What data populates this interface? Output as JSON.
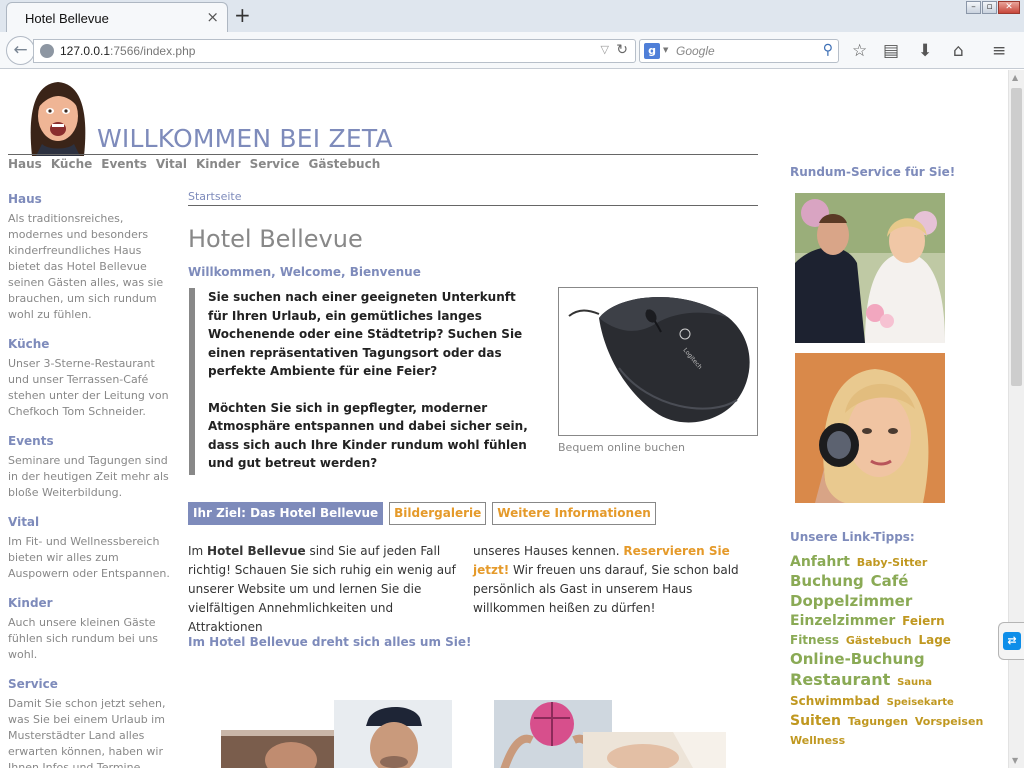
{
  "colors": {
    "accent_blue": "#7e8bbb",
    "accent_orange": "#e59a2a",
    "tag_green": "#8aaa55",
    "tag_gold": "#c09820",
    "text_gray": "#888888"
  },
  "browser": {
    "tab_title": "Hotel Bellevue",
    "tab_close": "×",
    "new_tab": "+",
    "url_host": "127.0.0.1",
    "url_rest": ":7566/index.php",
    "search_placeholder": "Google",
    "search_engine_letter": "g",
    "icons": [
      "back-arrow-icon",
      "globe-icon",
      "dropdown-icon",
      "reload-icon",
      "google-icon",
      "search-icon",
      "star-icon",
      "reading-list-icon",
      "download-icon",
      "home-icon",
      "menu-icon"
    ]
  },
  "header": {
    "title": "WILLKOMMEN BEI ZETA",
    "nav": [
      "Haus",
      "Küche",
      "Events",
      "Vital",
      "Kinder",
      "Service",
      "Gästebuch"
    ]
  },
  "sidebar": {
    "sections": [
      {
        "title": "Haus",
        "text": "Als traditionsreiches, modernes und besonders kinderfreundliches Haus bietet das Hotel Bellevue seinen Gästen alles, was sie brauchen, um sich rundum wohl zu fühlen."
      },
      {
        "title": "Küche",
        "text": "Unser 3-Sterne-Restaurant und unser Terrassen-Café stehen unter der Leitung von Chefkoch Tom Schneider."
      },
      {
        "title": "Events",
        "text": "Seminare und Tagungen sind in der heutigen Zeit mehr als bloße Weiterbildung."
      },
      {
        "title": "Vital",
        "text": "Im Fit- und Wellnessbereich bieten wir alles zum Auspowern oder Entspannen."
      },
      {
        "title": "Kinder",
        "text": "Auch unsere kleinen Gäste fühlen sich rundum bei uns wohl."
      },
      {
        "title": "Service",
        "text": "Damit Sie schon jetzt sehen, was Sie bei einem Urlaub im Musterstädter Land alles erwarten können, haben wir Ihnen Infos und Termine zusammengestellt."
      }
    ]
  },
  "main": {
    "breadcrumb": "Startseite",
    "heading": "Hotel Bellevue",
    "welcome": "Willkommen, Welcome, Bienvenue",
    "intro_p1": "Sie suchen nach einer geeigneten Unterkunft für Ihren Urlaub, ein gemütliches langes Wochenende oder eine Städtetrip? Suchen Sie einen repräsentativen Tagungsort oder das perfekte Ambiente für eine Feier?",
    "intro_p2": "Möchten Sie sich in gepflegter, moderner Atmosphäre entspannen und dabei sicher sein, dass sich auch Ihre Kinder rundum wohl fühlen und gut betreut werden?",
    "image_caption": "Bequem online buchen",
    "mouse_brand": "Logitech",
    "tabs": [
      "Ihr Ziel: Das Hotel Bellevue",
      "Bildergalerie",
      "Weitere Informationen"
    ],
    "col_a_pre": "Im ",
    "col_a_bold": "Hotel Bellevue",
    "col_a_post": " sind Sie auf jeden Fall richtig! Schauen Sie sich ruhig ein wenig auf unserer Website um und lernen Sie die vielfältigen Annehmlichkeiten und Attraktionen",
    "col_b_pre": "unseres Hauses kennen. ",
    "col_b_link": "Reservieren Sie jetzt!",
    "col_b_post": " Wir freuen uns darauf, Sie schon bald persönlich als Gast in unserem Haus willkommen heißen zu dürfen!",
    "tagline": "Im Hotel Bellevue dreht sich alles um Sie!"
  },
  "right": {
    "heading1": "Rundum-Service für Sie!",
    "heading2": "Unsere Link-Tipps:",
    "tags": [
      {
        "label": "Anfahrt",
        "size": "s4",
        "color": "green"
      },
      {
        "label": "Baby-Sitter",
        "size": "s2",
        "color": "gold"
      },
      {
        "label": "Buchung",
        "size": "s5",
        "color": "green"
      },
      {
        "label": "Café",
        "size": "s5",
        "color": "green"
      },
      {
        "label": "Doppelzimmer",
        "size": "s5",
        "color": "green"
      },
      {
        "label": "Einzelzimmer",
        "size": "s4",
        "color": "green"
      },
      {
        "label": "Feiern",
        "size": "s3",
        "color": "gold"
      },
      {
        "label": "Fitness",
        "size": "s3",
        "color": "green"
      },
      {
        "label": "Gästebuch",
        "size": "s2",
        "color": "gold"
      },
      {
        "label": "Lage",
        "size": "s3",
        "color": "gold"
      },
      {
        "label": "Online-Buchung",
        "size": "s5",
        "color": "green"
      },
      {
        "label": "Restaurant",
        "size": "s6",
        "color": "green"
      },
      {
        "label": "Sauna",
        "size": "s1",
        "color": "gold"
      },
      {
        "label": "Schwimmbad",
        "size": "s3",
        "color": "gold"
      },
      {
        "label": "Speisekarte",
        "size": "s1",
        "color": "gold"
      },
      {
        "label": "Suiten",
        "size": "s4",
        "color": "gold"
      },
      {
        "label": "Tagungen",
        "size": "s2",
        "color": "gold"
      },
      {
        "label": "Vorspeisen",
        "size": "s2",
        "color": "gold"
      },
      {
        "label": "Wellness",
        "size": "s2",
        "color": "gold"
      }
    ]
  }
}
